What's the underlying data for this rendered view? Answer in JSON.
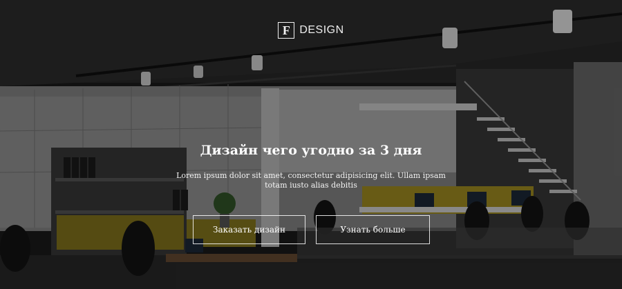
{
  "logo": {
    "mark": "F",
    "word": "DESIGN"
  },
  "hero": {
    "title": "Дизайн чего угодно за 3 дня",
    "lead": "Lorem ipsum dolor sit amet, consectetur adipisicing elit. Ullam ipsam totam iusto alias debitis",
    "buttons": {
      "order_label": "Заказать дизайн",
      "more_label": "Узнать больше"
    }
  },
  "colors": {
    "text": "#ffffff",
    "accent_yellow": "#c9b020",
    "overlay": "#000000"
  }
}
